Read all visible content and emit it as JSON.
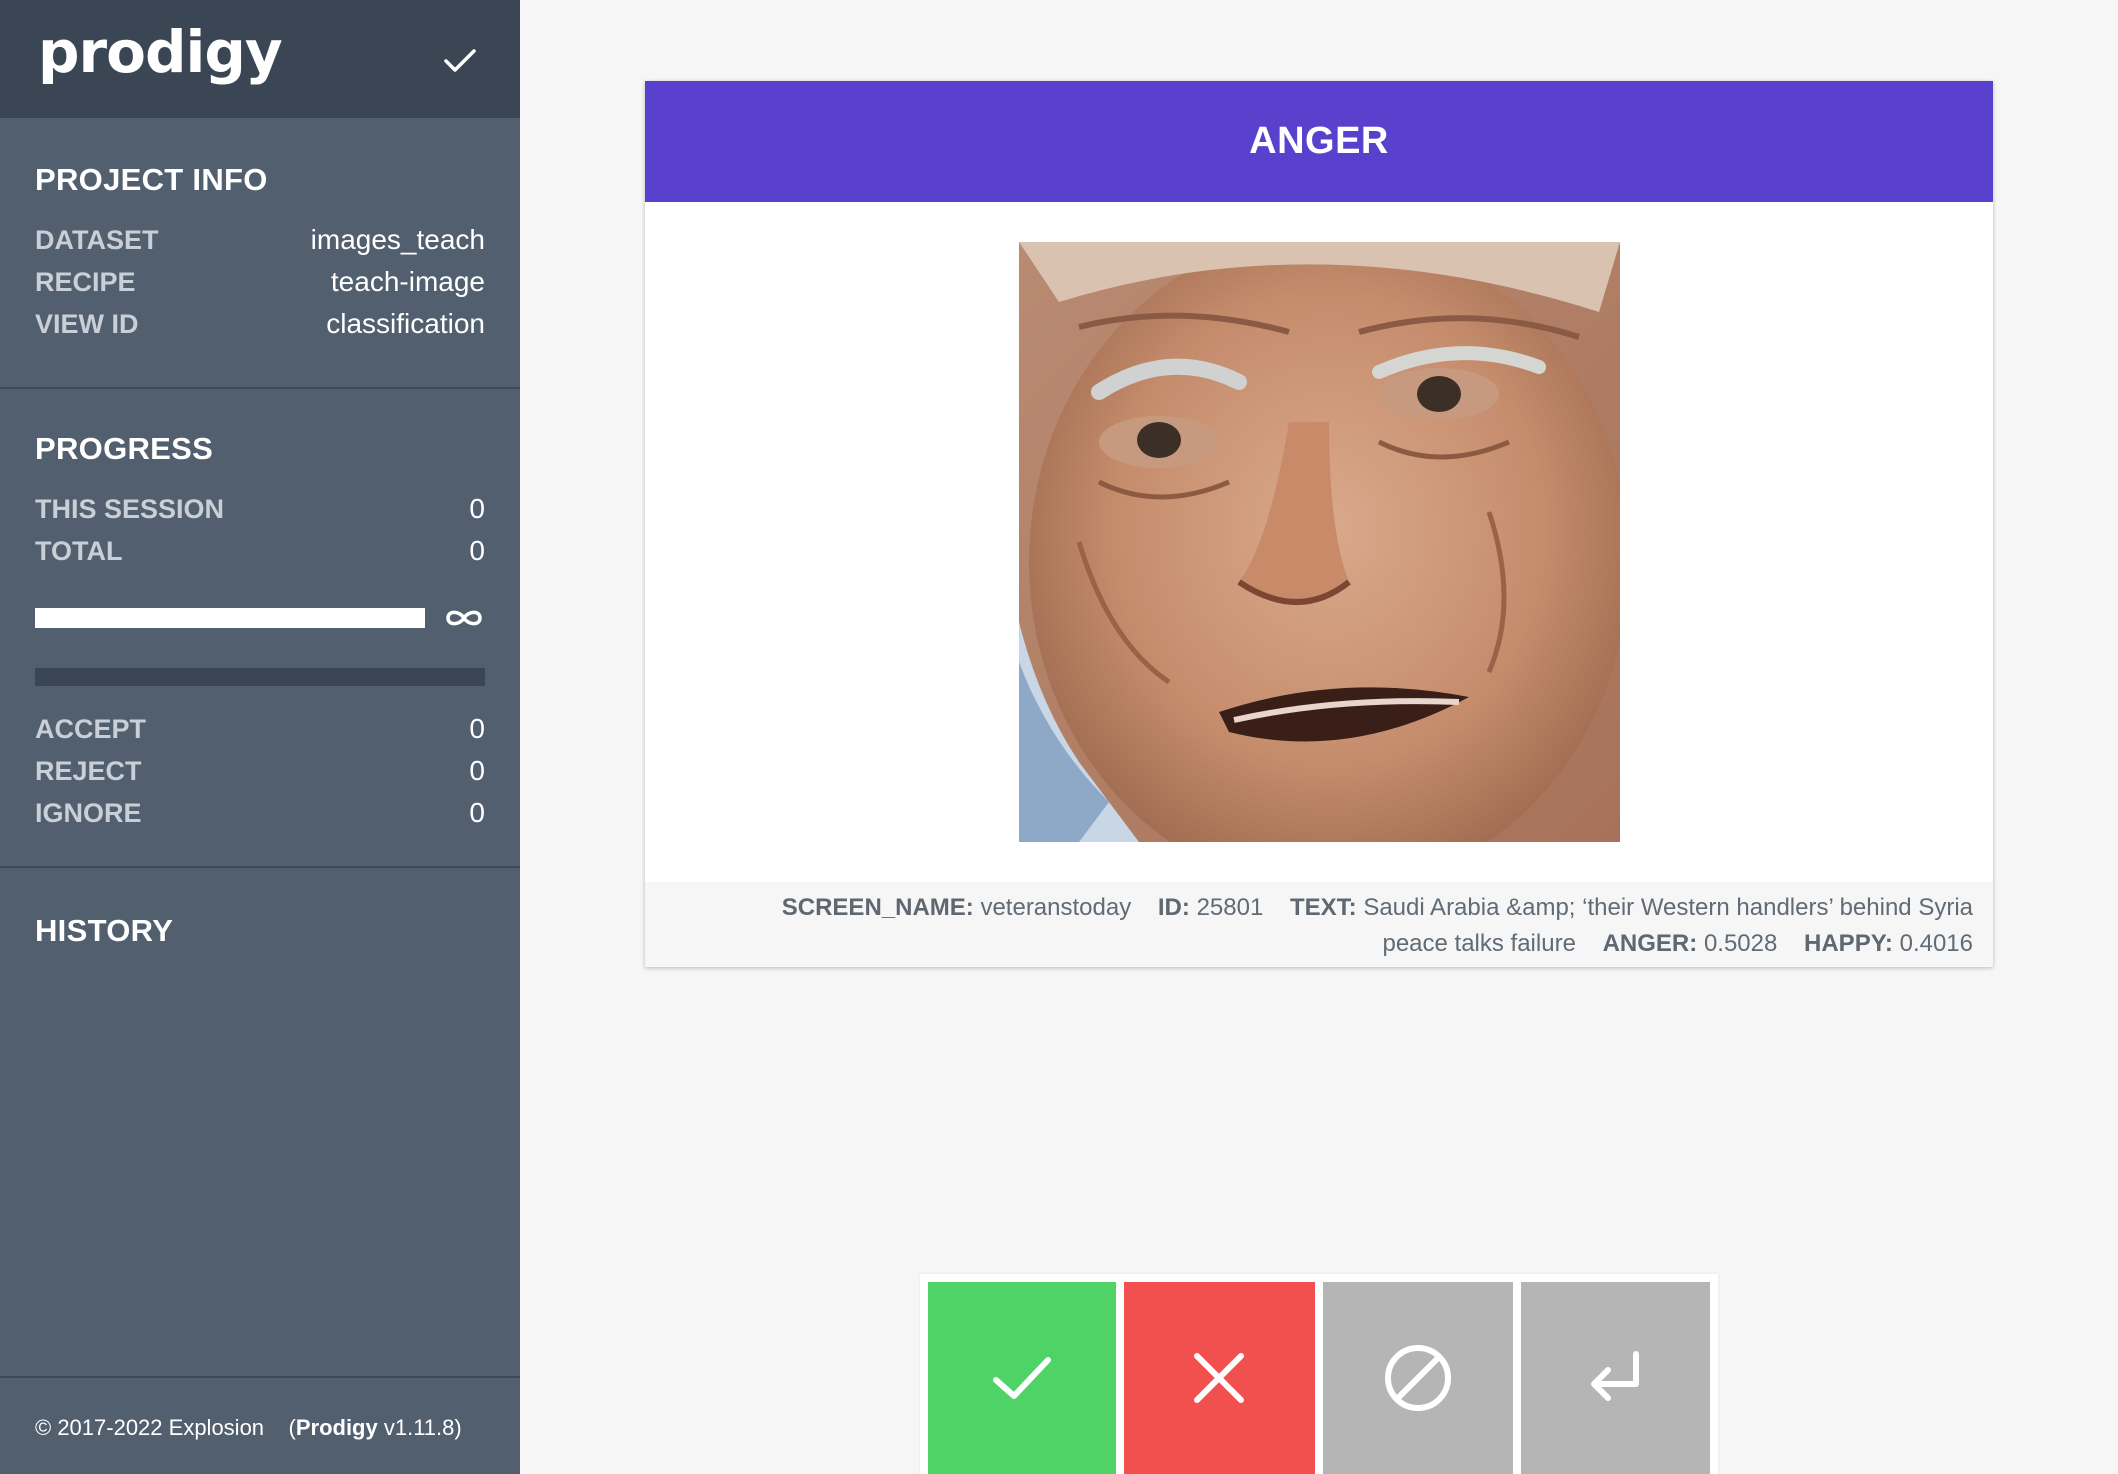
{
  "app": {
    "logo_text": "prodigy",
    "header_icon": "check-icon"
  },
  "project_info": {
    "title": "PROJECT INFO",
    "rows": [
      {
        "label": "DATASET",
        "value": "images_teach"
      },
      {
        "label": "RECIPE",
        "value": "teach-image"
      },
      {
        "label": "VIEW ID",
        "value": "classification"
      }
    ]
  },
  "progress": {
    "title": "PROGRESS",
    "session_label": "THIS SESSION",
    "session_value": "0",
    "total_label": "TOTAL",
    "total_value": "0",
    "progress_fraction": 1.0,
    "progress_symbol": "infinity-icon",
    "counts": [
      {
        "label": "ACCEPT",
        "value": "0"
      },
      {
        "label": "REJECT",
        "value": "0"
      },
      {
        "label": "IGNORE",
        "value": "0"
      }
    ]
  },
  "history": {
    "title": "HISTORY"
  },
  "footer": {
    "copyright": "© 2017-2022 Explosion",
    "product": "Prodigy",
    "version": "v1.11.8)",
    "open_paren": "("
  },
  "card": {
    "label": "ANGER",
    "label_color": "#5940cd",
    "image_alt": "face photo",
    "meta": [
      {
        "key": "SCREEN_NAME:",
        "value": "veteranstoday"
      },
      {
        "key": "ID:",
        "value": "25801"
      },
      {
        "key": "TEXT:",
        "value": "Saudi Arabia &amp; ‘their Western handlers’ behind Syria peace talks failure"
      },
      {
        "key": "ANGER:",
        "value": "0.5028"
      },
      {
        "key": "HAPPY:",
        "value": "0.4016"
      }
    ]
  },
  "actions": {
    "accept_icon": "check-icon",
    "accept_color": "#50d366",
    "reject_icon": "close-icon",
    "reject_color": "#f2504f",
    "ignore_icon": "ban-icon",
    "ignore_color": "#b5b5b5",
    "undo_icon": "undo-icon"
  }
}
